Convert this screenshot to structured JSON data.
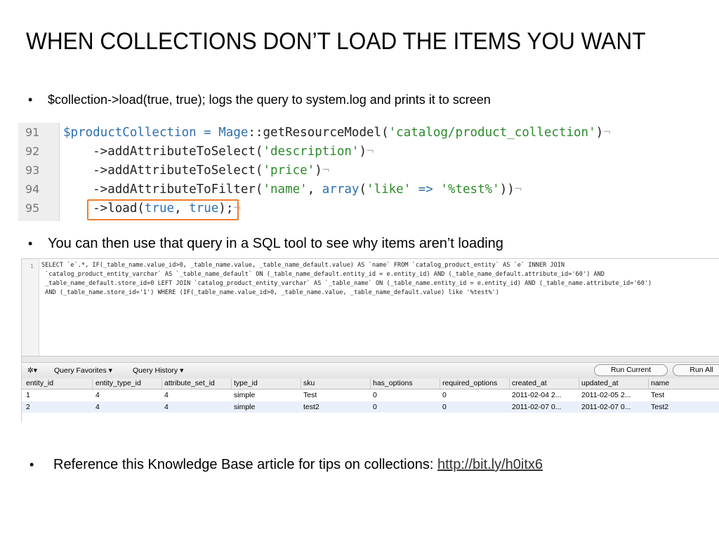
{
  "title": "WHEN COLLECTIONS DON’T LOAD THE ITEMS YOU WANT",
  "bullets": {
    "b1": "$collection->load(true, true); logs the query to system.log and prints it to screen",
    "b2": "You can then use that query in a SQL tool to see why items aren’t loading",
    "b3_text": "Reference this Knowledge Base article for tips on collections: ",
    "b3_link": "http://bit.ly/h0itx6"
  },
  "code": {
    "line_numbers": [
      "91",
      "92",
      "93",
      "94",
      "95"
    ],
    "l91": {
      "var": "$productCollection",
      "eq": " = ",
      "cls": "Mage",
      "sep": "::",
      "fn": "getResourceModel(",
      "str": "'catalog/product_collection'",
      "end": ")"
    },
    "l92": {
      "fn": "    ->addAttributeToSelect(",
      "str": "'description'",
      "end": ")"
    },
    "l93": {
      "fn": "    ->addAttributeToSelect(",
      "str": "'price'",
      "end": ")"
    },
    "l94": {
      "fn": "    ->addAttributeToFilter(",
      "str1": "'name'",
      "comma": ", ",
      "arr": "array",
      "open": "(",
      "str2": "'like'",
      "arrow": " => ",
      "str3": "'%test%'",
      "end": "))"
    },
    "l95": {
      "fn": "    ->load(",
      "b1": "true",
      "comma": ", ",
      "b2": "true",
      "end": ");"
    },
    "pilcrow": "¬"
  },
  "sql": {
    "gutter_number": "1",
    "query_lines": [
      "SELECT `e`.*, IF(_table_name.value_id>0, _table_name.value, _table_name_default.value) AS `name` FROM `catalog_product_entity` AS `e` INNER JOIN",
      " `catalog_product_entity_varchar` AS `_table_name_default` ON (_table_name_default.entity_id = e.entity_id) AND (_table_name_default.attribute_id='60') AND",
      " _table_name_default.store_id=0 LEFT JOIN `catalog_product_entity_varchar` AS `_table_name` ON (_table_name.entity_id = e.entity_id) AND (_table_name.attribute_id='60')",
      " AND (_table_name.store_id='1') WHERE (IF(_table_name.value_id>0, _table_name.value, _table_name_default.value) like '%test%')"
    ],
    "toolbar": {
      "gear": "✲▾",
      "favorites": "Query Favorites ▾",
      "history": "Query History ▾",
      "run_current": "Run Current",
      "run_all": "Run All"
    },
    "columns": [
      "entity_id",
      "entity_type_id",
      "attribute_set_id",
      "type_id",
      "sku",
      "has_options",
      "required_options",
      "created_at",
      "updated_at",
      "name"
    ],
    "rows": [
      [
        "1",
        "4",
        "4",
        "simple",
        "Test",
        "0",
        "0",
        "2011-02-04 2...",
        "2011-02-05 2...",
        "Test"
      ],
      [
        "2",
        "4",
        "4",
        "simple",
        "test2",
        "0",
        "0",
        "2011-02-07 0...",
        "2011-02-07 0...",
        "Test2"
      ]
    ],
    "colors": {
      "keyword": "#3a5fcd",
      "string": "#c03030",
      "row_alt": "#eaf0fb"
    }
  },
  "colors": {
    "highlight_box": "#ef7d2f",
    "code_variable": "#2f6fae",
    "code_string": "#2b8a2b"
  }
}
